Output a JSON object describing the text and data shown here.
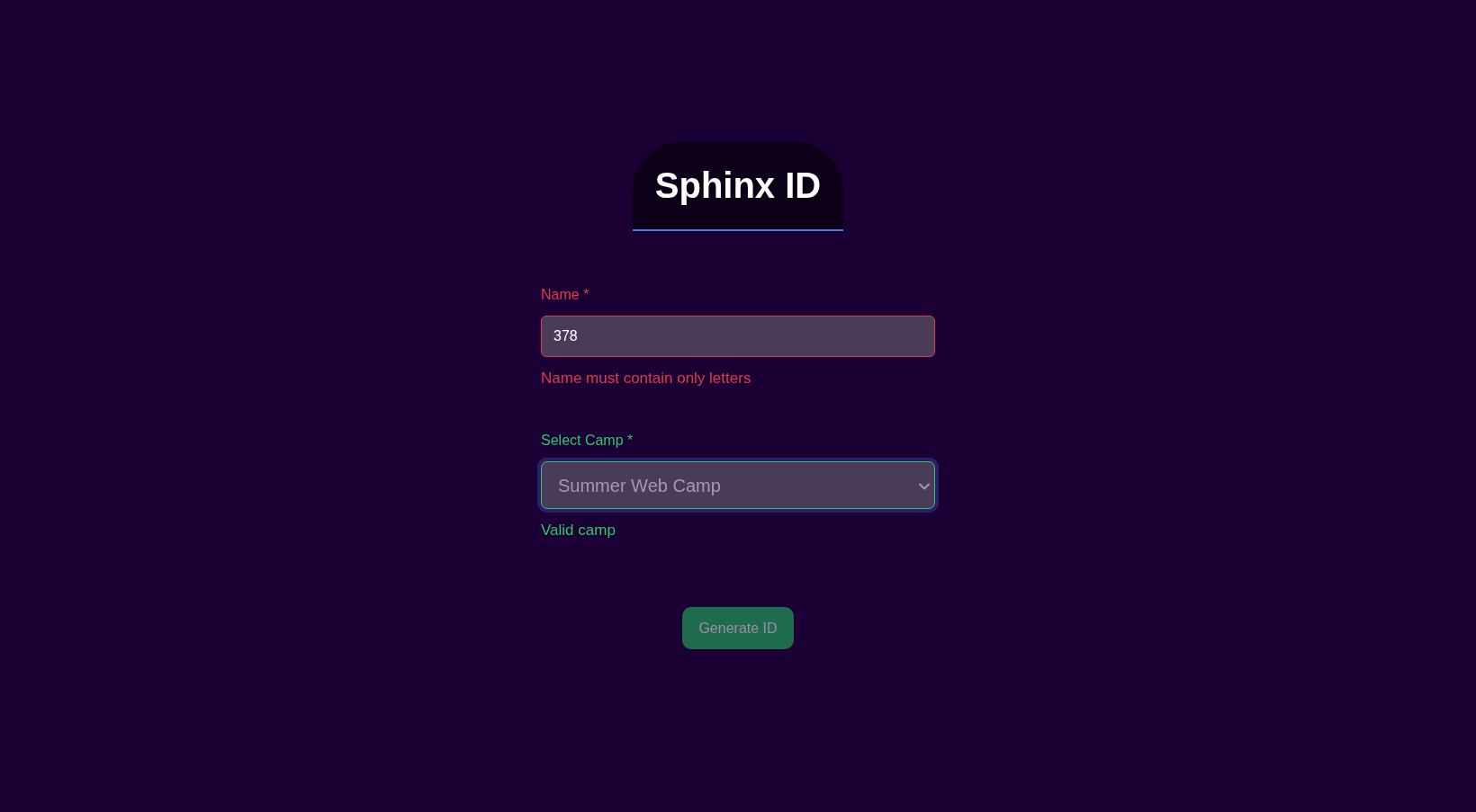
{
  "title": "Sphinx ID",
  "fields": [
    {
      "kind": "text",
      "label": "Name *",
      "value": "378",
      "invalid": true,
      "focused": false,
      "message": "Name must contain only letters"
    },
    {
      "kind": "select",
      "label": "Select Camp *",
      "value": "Summer Web Camp",
      "invalid": false,
      "focused": true,
      "message": "Valid camp"
    }
  ],
  "submit": {
    "label": "Generate ID",
    "disabled": true
  }
}
